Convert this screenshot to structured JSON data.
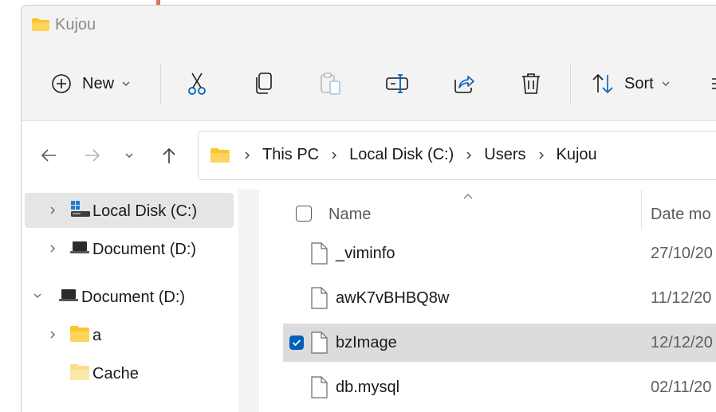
{
  "window": {
    "title": "Kujou"
  },
  "toolbar": {
    "new_label": "New",
    "sort_label": "Sort",
    "icons": [
      "plus-circle-icon",
      "cut-icon",
      "copy-icon",
      "paste-icon",
      "rename-icon",
      "share-icon",
      "delete-icon",
      "sort-icon",
      "view-icon"
    ]
  },
  "breadcrumb": {
    "items": [
      "This PC",
      "Local Disk (C:)",
      "Users",
      "Kujou"
    ]
  },
  "sidebar": {
    "items": [
      {
        "label": "Local Disk (C:)",
        "icon": "drive-icon",
        "selected": true
      },
      {
        "label": "Document (D:)",
        "icon": "laptop-drive-icon"
      },
      {
        "label": "Document (D:)",
        "icon": "laptop-drive-icon",
        "expanded": true
      },
      {
        "label": "a",
        "icon": "folder-icon"
      },
      {
        "label": "Cache",
        "icon": "folder-icon"
      }
    ]
  },
  "filelist": {
    "columns": {
      "name": "Name",
      "date": "Date mo"
    },
    "rows": [
      {
        "name": "_viminfo",
        "date": "27/10/20",
        "selected": false
      },
      {
        "name": "awK7vBHBQ8w",
        "date": "11/12/20",
        "selected": false
      },
      {
        "name": "bzImage",
        "date": "12/12/20",
        "selected": true
      },
      {
        "name": "db.mysql",
        "date": "02/11/20",
        "selected": false
      }
    ]
  },
  "colors": {
    "accent": "#005fb8",
    "folder": "#f8c62f",
    "selection": "#dcdcdc"
  }
}
